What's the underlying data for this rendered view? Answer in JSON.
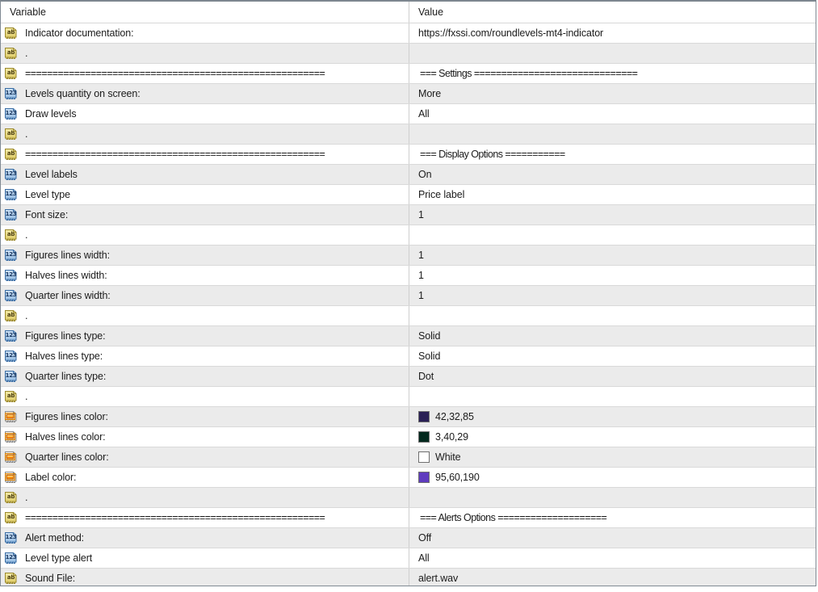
{
  "table": {
    "columns": {
      "variable": "Variable",
      "value": "Value"
    },
    "rows": [
      {
        "icon": "string-type-icon",
        "name": "Indicator documentation:",
        "value": "https://fxssi.com/roundlevels-mt4-indicator"
      },
      {
        "icon": "string-type-icon",
        "name": ".",
        "value": ""
      },
      {
        "icon": "string-type-icon",
        "name": "=======================================================",
        "value": "=== Settings ==============================",
        "separator": true
      },
      {
        "icon": "number-type-icon",
        "name": "Levels quantity on screen:",
        "value": "More"
      },
      {
        "icon": "number-type-icon",
        "name": "Draw levels",
        "value": "All"
      },
      {
        "icon": "string-type-icon",
        "name": ".",
        "value": ""
      },
      {
        "icon": "string-type-icon",
        "name": "=======================================================",
        "value": "=== Display Options ===========",
        "separator": true
      },
      {
        "icon": "number-type-icon",
        "name": "Level labels",
        "value": "On"
      },
      {
        "icon": "number-type-icon",
        "name": "Level type",
        "value": "Price label"
      },
      {
        "icon": "number-type-icon",
        "name": "Font size:",
        "value": "1"
      },
      {
        "icon": "string-type-icon",
        "name": ".",
        "value": ""
      },
      {
        "icon": "number-type-icon",
        "name": "Figures lines width:",
        "value": "1"
      },
      {
        "icon": "number-type-icon",
        "name": "Halves lines width:",
        "value": "1"
      },
      {
        "icon": "number-type-icon",
        "name": "Quarter lines width:",
        "value": "1"
      },
      {
        "icon": "string-type-icon",
        "name": ".",
        "value": ""
      },
      {
        "icon": "number-type-icon",
        "name": "Figures lines type:",
        "value": "Solid"
      },
      {
        "icon": "number-type-icon",
        "name": "Halves lines type:",
        "value": "Solid"
      },
      {
        "icon": "number-type-icon",
        "name": "Quarter lines type:",
        "value": "Dot"
      },
      {
        "icon": "string-type-icon",
        "name": ".",
        "value": ""
      },
      {
        "icon": "color-type-icon",
        "name": "Figures lines color:",
        "value": "42,32,85",
        "swatch": "#2a2055"
      },
      {
        "icon": "color-type-icon",
        "name": "Halves lines color:",
        "value": "3,40,29",
        "swatch": "#03281d"
      },
      {
        "icon": "color-type-icon",
        "name": "Quarter lines color:",
        "value": "White",
        "swatch": "#ffffff"
      },
      {
        "icon": "color-type-icon",
        "name": "Label color:",
        "value": "95,60,190",
        "swatch": "#5f3cbe"
      },
      {
        "icon": "string-type-icon",
        "name": ".",
        "value": ""
      },
      {
        "icon": "string-type-icon",
        "name": "=======================================================",
        "value": "=== Alerts Options ====================",
        "separator": true
      },
      {
        "icon": "number-type-icon",
        "name": "Alert method:",
        "value": "Off"
      },
      {
        "icon": "number-type-icon",
        "name": "Level type alert",
        "value": "All"
      },
      {
        "icon": "string-type-icon",
        "name": "Sound File:",
        "value": "alert.wav"
      }
    ]
  },
  "icons": {
    "string-type-icon": {
      "glyph": "ab",
      "kind": "string"
    },
    "number-type-icon": {
      "glyph": "123",
      "kind": "number"
    },
    "color-type-icon": {
      "glyph": "",
      "kind": "color"
    }
  },
  "colors": {
    "figures_lines": "#2a2055",
    "halves_lines": "#03281d",
    "quarter_lines": "#ffffff",
    "label": "#5f3cbe"
  }
}
